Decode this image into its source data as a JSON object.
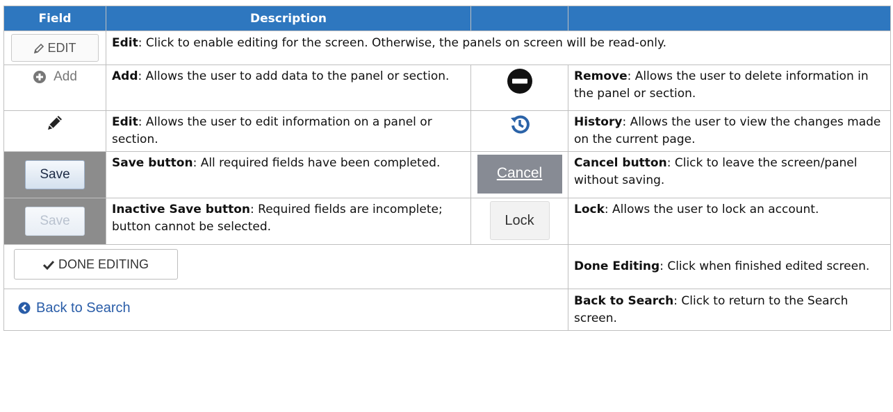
{
  "table": {
    "headers": {
      "field": "Field",
      "description": "Description",
      "col3": "",
      "col4": ""
    },
    "edit_row": {
      "button_label": "EDIT",
      "title": "Edit",
      "text": ": Click to enable editing for the screen. Otherwise, the panels on screen will be read-only."
    },
    "rows": [
      {
        "left_icon": "plus-circle-icon",
        "left_label": "Add",
        "left_title": "Add",
        "left_text": ": Allows the user to add data to the panel or section.",
        "right_icon": "minus-circle-icon",
        "right_title": "Remove",
        "right_text": ": Allows the user to delete information in the panel or section."
      },
      {
        "left_icon": "pencil-icon",
        "left_title": "Edit",
        "left_text": ": Allows the user to edit information on a panel or section.",
        "right_icon": "history-icon",
        "right_title": "History",
        "right_text": ": Allows the user to view the changes made on the current page."
      },
      {
        "left_label": "Save",
        "left_title": "Save button",
        "left_text": ": All required fields have been completed.",
        "right_label": "Cancel",
        "right_title": "Cancel button",
        "right_text": ": Click to leave the screen/panel without saving."
      },
      {
        "left_label": "Save",
        "left_title": "Inactive Save button",
        "left_text": ": Required fields are incomplete; button cannot be selected.",
        "right_label": "Lock",
        "right_title": "Lock",
        "right_text": ": Allows the user to lock an account."
      }
    ],
    "done_row": {
      "button_label": "DONE EDITING",
      "title": "Done Editing",
      "text": ": Click when finished edited screen."
    },
    "back_row": {
      "link_label": "Back to Search",
      "title": "Back to Search",
      "text": ": Click to return to the Search screen."
    }
  },
  "colors": {
    "header_bg": "#2e77bf",
    "link_blue": "#2a5da8",
    "frame_gray": "#8c8c8c"
  }
}
